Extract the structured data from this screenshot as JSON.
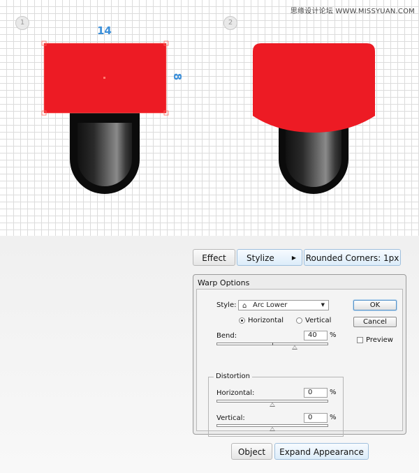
{
  "watermark": "思缘设计论坛 WWW.MISSYUAN.COM",
  "steps": [
    "1",
    "2"
  ],
  "dimensions": {
    "width": "14",
    "height": "8"
  },
  "colors": {
    "red": "#ed1b24",
    "accent": "#3b8fd9"
  },
  "toolbar": {
    "effect": "Effect",
    "stylize": "Stylize",
    "rounded": "Rounded Corners: 1px",
    "object": "Object",
    "expand": "Expand Appearance"
  },
  "dialog": {
    "title": "Warp Options",
    "style_label": "Style:",
    "style_value": "Arc Lower",
    "horizontal_label": "Horizontal",
    "vertical_label": "Vertical",
    "orientation": "horizontal",
    "bend_label": "Bend:",
    "bend_value": "40",
    "percent": "%",
    "distortion_label": "Distortion",
    "dist_h_label": "Horizontal:",
    "dist_h_value": "0",
    "dist_v_label": "Vertical:",
    "dist_v_value": "0",
    "ok": "OK",
    "cancel": "Cancel",
    "preview": "Preview",
    "preview_checked": false
  }
}
